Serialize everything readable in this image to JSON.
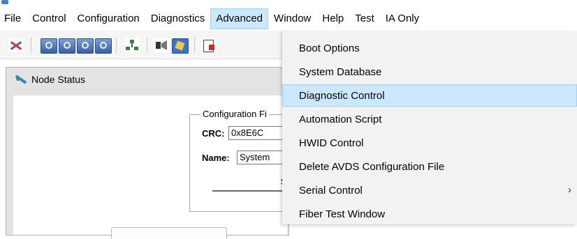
{
  "menubar": {
    "items": [
      {
        "label": "File"
      },
      {
        "label": "Control"
      },
      {
        "label": "Configuration"
      },
      {
        "label": "Diagnostics"
      },
      {
        "label": "Advanced"
      },
      {
        "label": "Window"
      },
      {
        "label": "Help"
      },
      {
        "label": "Test"
      },
      {
        "label": "IA Only"
      }
    ],
    "active": "Advanced"
  },
  "toolbar": {
    "icons": [
      "disconnect-icon",
      "node-icon",
      "node-icon",
      "node-icon",
      "node-icon",
      "network-tree-icon",
      "speaker-icon",
      "notepad-icon",
      "document-icon"
    ]
  },
  "child_window": {
    "title": "Node Status",
    "group_label": "Configuration Fi",
    "crc_label": "CRC:",
    "crc_value": "0x8E6C",
    "name_label": "Name:",
    "name_value": "System",
    "send_label": "Send"
  },
  "advanced_menu": {
    "items": [
      {
        "label": "Boot Options"
      },
      {
        "label": "System Database"
      },
      {
        "label": "Diagnostic Control",
        "highlighted": true
      },
      {
        "label": "Automation Script"
      },
      {
        "label": "HWID Control"
      },
      {
        "label": "Delete AVDS Configuration File"
      },
      {
        "label": "Serial Control",
        "submenu": true,
        "arrow": "›"
      },
      {
        "label": "Fiber Test Window"
      }
    ]
  },
  "colors": {
    "menu_highlight": "#cce8ff",
    "menu_highlight_border": "#99d1ff",
    "menu_background": "#f2f2f2"
  }
}
